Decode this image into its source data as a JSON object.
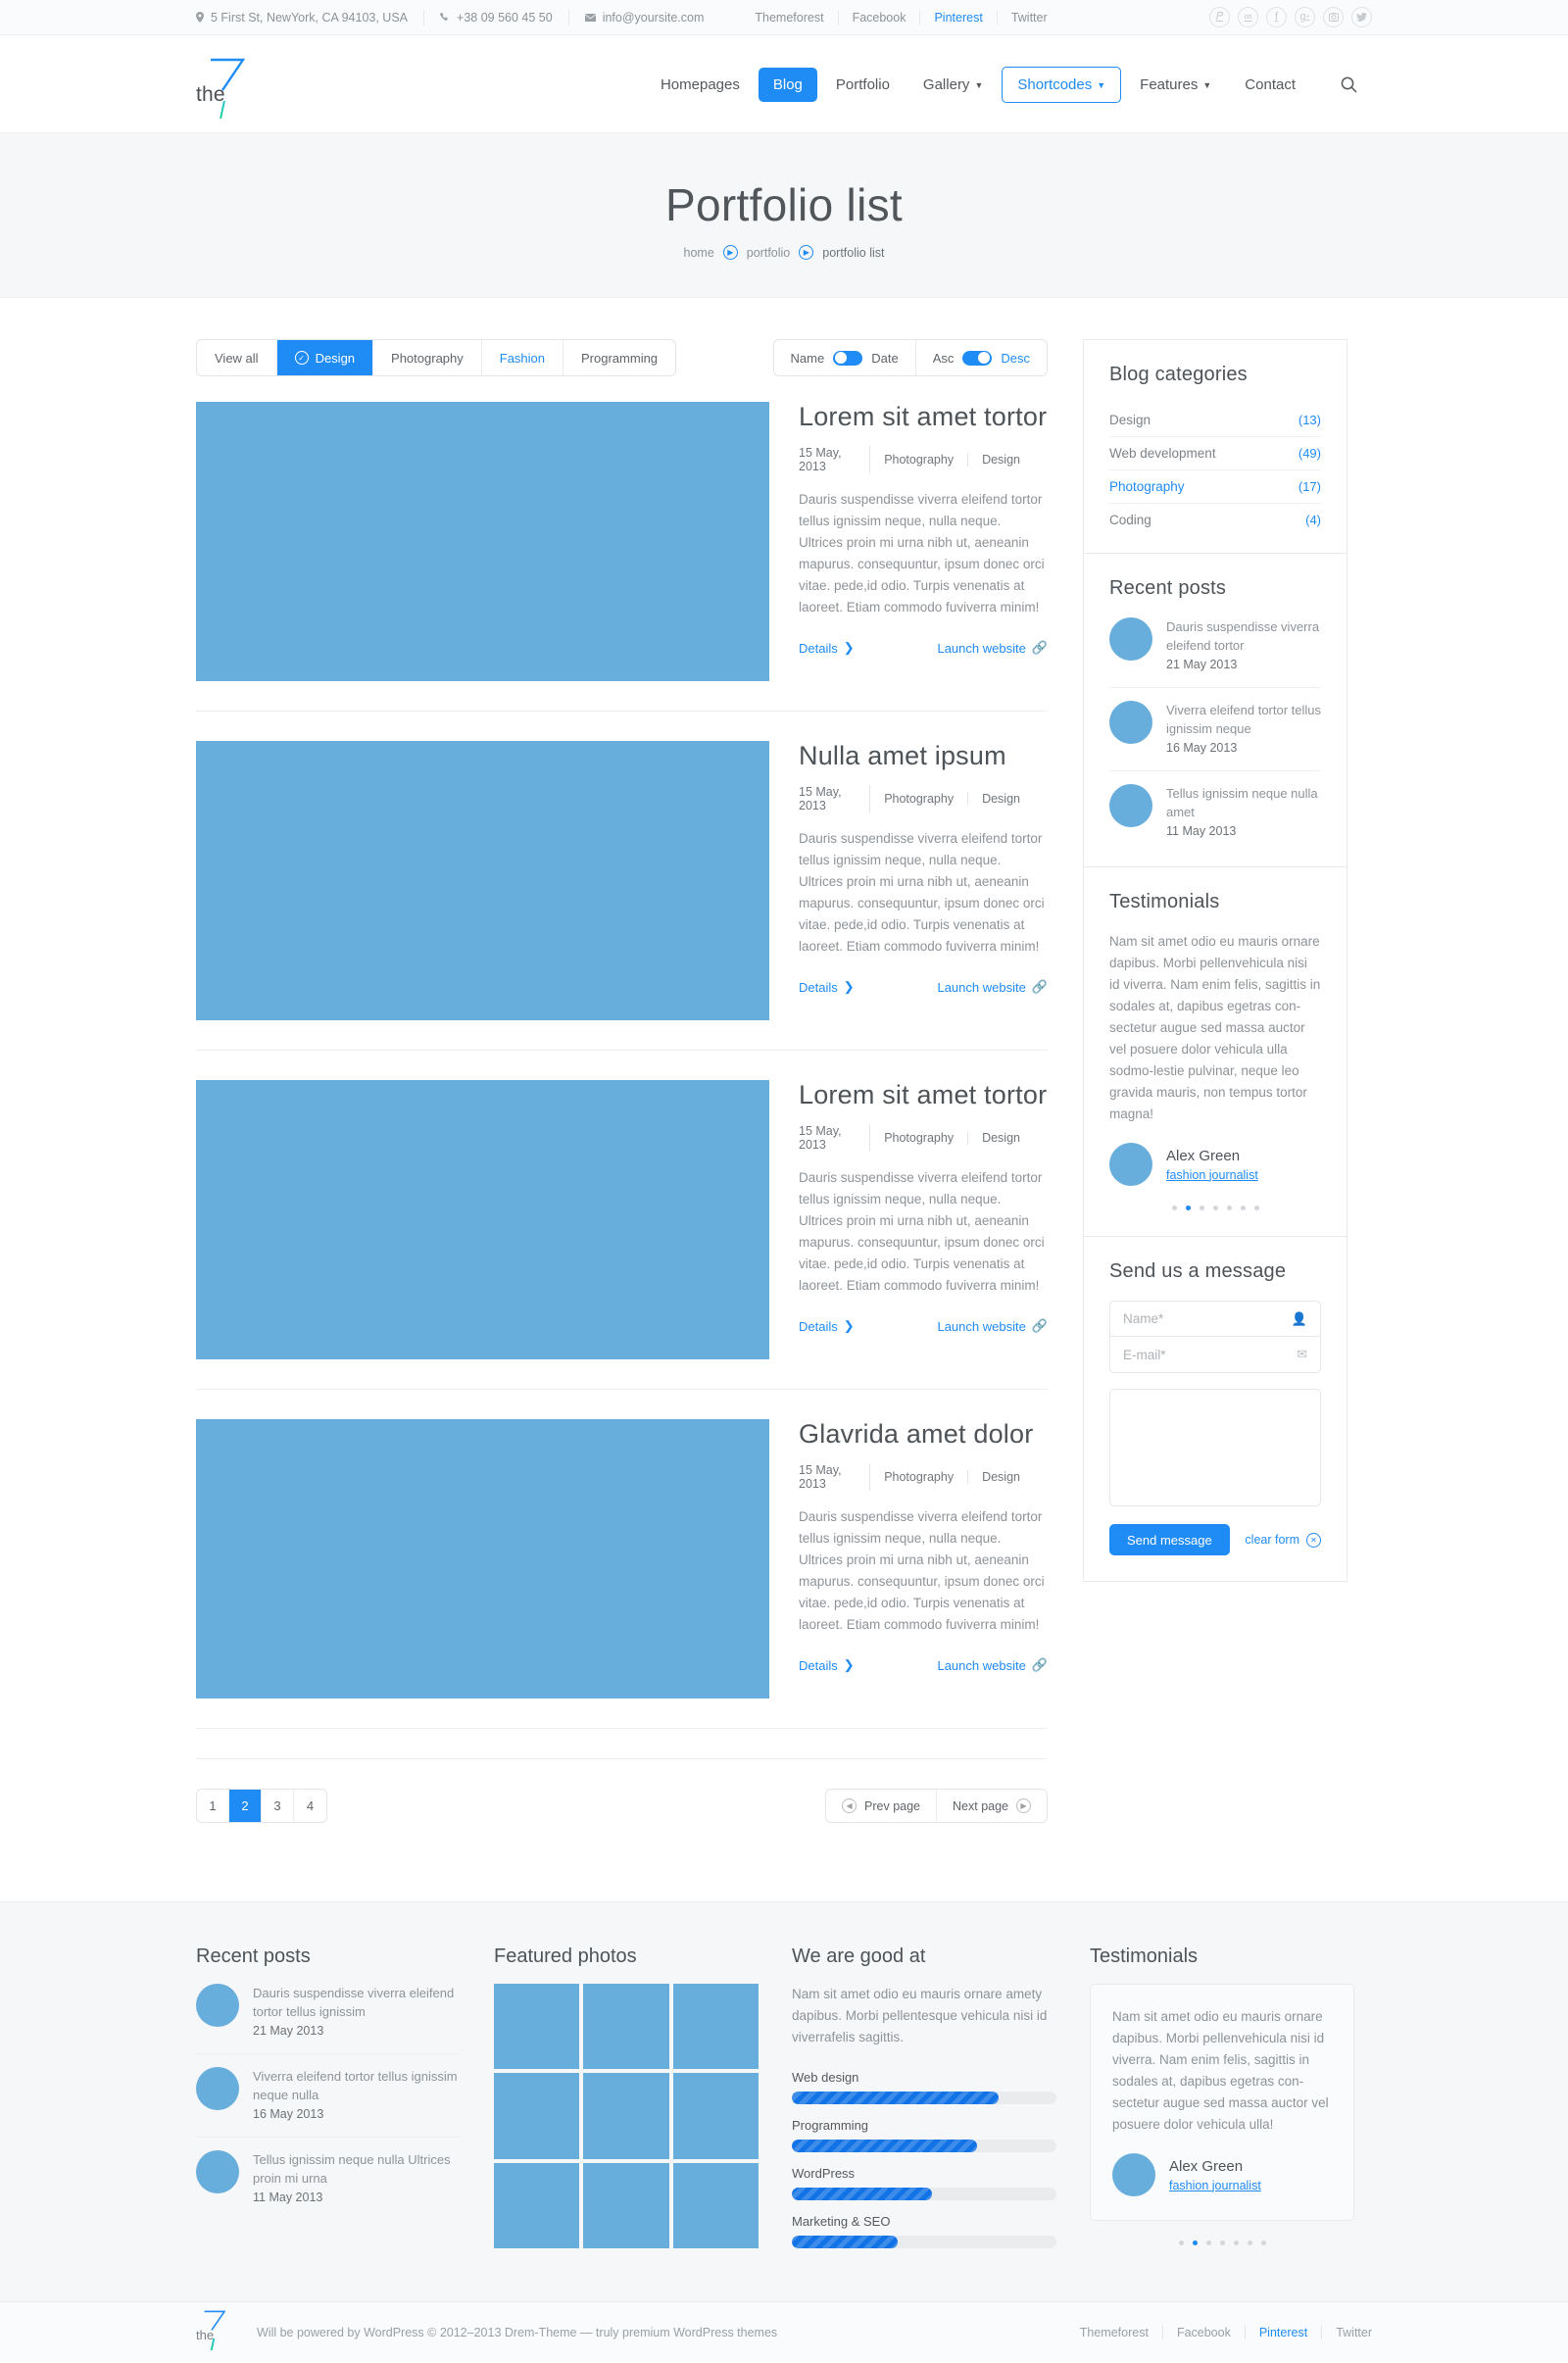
{
  "topbar": {
    "address": "5 First St, NewYork, CA 94103, USA",
    "phone": "+38 09 560 45 50",
    "email": "info@yoursite.com",
    "links": [
      {
        "label": "Themeforest",
        "accent": false
      },
      {
        "label": "Facebook",
        "accent": false
      },
      {
        "label": "Pinterest",
        "accent": true
      },
      {
        "label": "Twitter",
        "accent": false
      }
    ],
    "social": [
      "pinterest-icon",
      "fivehundredpx-icon",
      "facebook-icon",
      "googleplus-icon",
      "instagram-icon",
      "twitter-icon"
    ]
  },
  "logo": {
    "number": "7",
    "word": "the"
  },
  "nav": {
    "items": [
      {
        "label": "Homepages",
        "state": "default",
        "caret": false
      },
      {
        "label": "Blog",
        "state": "active",
        "caret": false
      },
      {
        "label": "Portfolio",
        "state": "default",
        "caret": false
      },
      {
        "label": "Gallery",
        "state": "default",
        "caret": true
      },
      {
        "label": "Shortcodes",
        "state": "outline",
        "caret": true
      },
      {
        "label": "Features",
        "state": "default",
        "caret": true
      },
      {
        "label": "Contact",
        "state": "default",
        "caret": false
      }
    ],
    "search": "search-icon"
  },
  "page": {
    "title": "Portfolio list",
    "breadcrumb": [
      "home",
      "portfolio",
      "portfolio list"
    ]
  },
  "filters": {
    "items": [
      {
        "label": "View all",
        "state": "default"
      },
      {
        "label": "Design",
        "state": "active"
      },
      {
        "label": "Photography",
        "state": "default"
      },
      {
        "label": "Fashion",
        "state": "link"
      },
      {
        "label": "Programming",
        "state": "default"
      }
    ],
    "sort_by": {
      "left": "Name",
      "right": "Date",
      "selected": "Name"
    },
    "sort_dir": {
      "left": "Asc",
      "right": "Desc",
      "selected": "Desc"
    }
  },
  "portfolio": {
    "items": [
      {
        "title": "Lorem sit amet tortor",
        "date": "15 May, 2013",
        "cat1": "Photography",
        "cat2": "Design",
        "text": "Dauris suspendisse viverra eleifend tortor tellus ignissim neque, nulla neque. Ultrices proin mi urna nibh ut, aeneanin mapurus. consequuntur, ipsum donec orci vitae. pede,id odio. Turpis venenatis at laoreet. Etiam commodo fuviverra minim!",
        "details": "Details",
        "launch": "Launch website"
      },
      {
        "title": "Nulla amet ipsum",
        "date": "15 May, 2013",
        "cat1": "Photography",
        "cat2": "Design",
        "text": "Dauris suspendisse viverra eleifend tortor tellus ignissim neque, nulla neque. Ultrices proin mi urna nibh ut, aeneanin mapurus. consequuntur, ipsum donec orci vitae. pede,id odio. Turpis venenatis at laoreet. Etiam commodo fuviverra minim!",
        "details": "Details",
        "launch": "Launch website"
      },
      {
        "title": "Lorem sit amet tortor",
        "date": "15 May, 2013",
        "cat1": "Photography",
        "cat2": "Design",
        "text": "Dauris suspendisse viverra eleifend tortor tellus ignissim neque, nulla neque. Ultrices proin mi urna nibh ut, aeneanin mapurus. consequuntur, ipsum donec orci vitae. pede,id odio. Turpis venenatis at laoreet. Etiam commodo fuviverra minim!",
        "details": "Details",
        "launch": "Launch website"
      },
      {
        "title": "Glavrida amet dolor",
        "date": "15 May, 2013",
        "cat1": "Photography",
        "cat2": "Design",
        "text": "Dauris suspendisse viverra eleifend tortor tellus ignissim neque, nulla neque. Ultrices proin mi urna nibh ut, aeneanin mapurus. consequuntur, ipsum donec orci vitae. pede,id odio. Turpis venenatis at laoreet. Etiam commodo fuviverra minim!",
        "details": "Details",
        "launch": "Launch website"
      }
    ]
  },
  "pagination": {
    "pages": [
      "1",
      "2",
      "3",
      "4"
    ],
    "current": "2",
    "prev": "Prev page",
    "next": "Next page"
  },
  "sidebar": {
    "categories": {
      "title": "Blog categories",
      "items": [
        {
          "label": "Design",
          "count": "(13)",
          "active": false
        },
        {
          "label": "Web development",
          "count": "(49)",
          "active": false
        },
        {
          "label": "Photography",
          "count": "(17)",
          "active": true
        },
        {
          "label": "Coding",
          "count": "(4)",
          "active": false
        }
      ]
    },
    "recent": {
      "title": "Recent posts",
      "items": [
        {
          "text": "Dauris suspendisse viverra eleifend tortor",
          "date": "21 May 2013"
        },
        {
          "text": "Viverra eleifend tortor tellus ignissim neque",
          "date": "16 May 2013"
        },
        {
          "text": "Tellus ignissim neque nulla amet",
          "date": "11 May 2013"
        }
      ]
    },
    "testimonials": {
      "title": "Testimonials",
      "quote": "Nam sit amet odio eu mauris ornare dapibus. Morbi pellenvehicula nisi id viverra. Nam enim felis, sagittis in sodales at, dapibus egetras con-sectetur augue sed massa auctor vel posuere dolor vehicula ulla sodmo-lestie pulvinar, neque leo gravida mauris, non tempus tortor magna!",
      "name": "Alex Green",
      "role": "fashion journalist",
      "dots": 7,
      "active_dot": 1
    },
    "contact": {
      "title": "Send us a message",
      "name_placeholder": "Name*",
      "email_placeholder": "E-mail*",
      "message_placeholder": "",
      "submit": "Send message",
      "clear": "clear form"
    }
  },
  "footer": {
    "recent": {
      "title": "Recent posts",
      "items": [
        {
          "text": "Dauris suspendisse viverra eleifend tortor tellus ignissim",
          "date": "21 May 2013"
        },
        {
          "text": "Viverra eleifend tortor tellus ignissim neque nulla",
          "date": "16 May 2013"
        },
        {
          "text": "Tellus ignissim neque nulla Ultrices proin mi urna",
          "date": "11 May 2013"
        }
      ]
    },
    "photos": {
      "title": "Featured photos",
      "count": 9
    },
    "skills": {
      "title": "We are good at",
      "text": "Nam sit amet odio eu mauris ornare amety dapibus. Morbi pellentesque vehicula nisi id viverrafelis sagittis.",
      "items": [
        {
          "label": "Web design",
          "value": 78
        },
        {
          "label": "Programming",
          "value": 70
        },
        {
          "label": "WordPress",
          "value": 53
        },
        {
          "label": "Marketing & SEO",
          "value": 40
        }
      ]
    },
    "testimonials": {
      "title": "Testimonials",
      "quote": "Nam sit amet odio eu mauris ornare dapibus. Morbi pellenvehicula nisi id viverra. Nam enim felis, sagittis in sodales at, dapibus egetras con-sectetur augue sed massa auctor vel posuere dolor vehicula ulla!",
      "name": "Alex Green",
      "role": "fashion journalist",
      "dots": 7,
      "active_dot": 1
    },
    "bottom": {
      "copyright": "Will be powered by WordPress © 2012–2013 Drem-Theme — truly premium WordPress themes",
      "links": [
        {
          "label": "Themeforest",
          "accent": false
        },
        {
          "label": "Facebook",
          "accent": false
        },
        {
          "label": "Pinterest",
          "accent": true
        },
        {
          "label": "Twitter",
          "accent": false
        }
      ]
    }
  },
  "colors": {
    "accent": "#1f8bf5",
    "thumb": "#68aedd",
    "bar": "#1273e6"
  }
}
